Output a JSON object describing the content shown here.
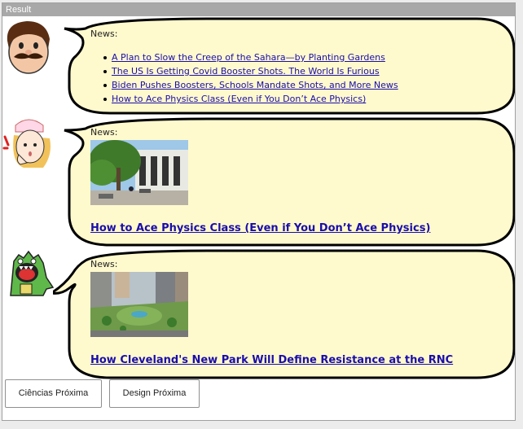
{
  "window": {
    "title": "Result"
  },
  "posts": [
    {
      "label": "News:",
      "links": [
        "A Plan to Slow the Creep of the Sahara—by Planting Gardens",
        "The US Is Getting Covid Booster Shots. The World Is Furious",
        "Biden Pushes Boosters, Schools Mandate Shots, and More News",
        "How to Ace Physics Class (Even if You Don’t Ace Physics)"
      ]
    },
    {
      "label": "News:",
      "headline": "How to Ace Physics Class (Even if You Don’t Ace Physics)"
    },
    {
      "label": "News:",
      "headline": "How Cleveland's New Park Will Define Resistance at the RNC"
    }
  ],
  "buttons": {
    "science_next": "Ciências Próxima",
    "design_next": "Design Próxima"
  },
  "colors": {
    "bubble_fill": "#fffacd",
    "link": "#1a0dab",
    "title_bar": "#a8a8a8"
  },
  "icons": [
    "mustache-man-avatar-icon",
    "nurse-girl-avatar-icon",
    "green-monster-avatar-icon"
  ]
}
